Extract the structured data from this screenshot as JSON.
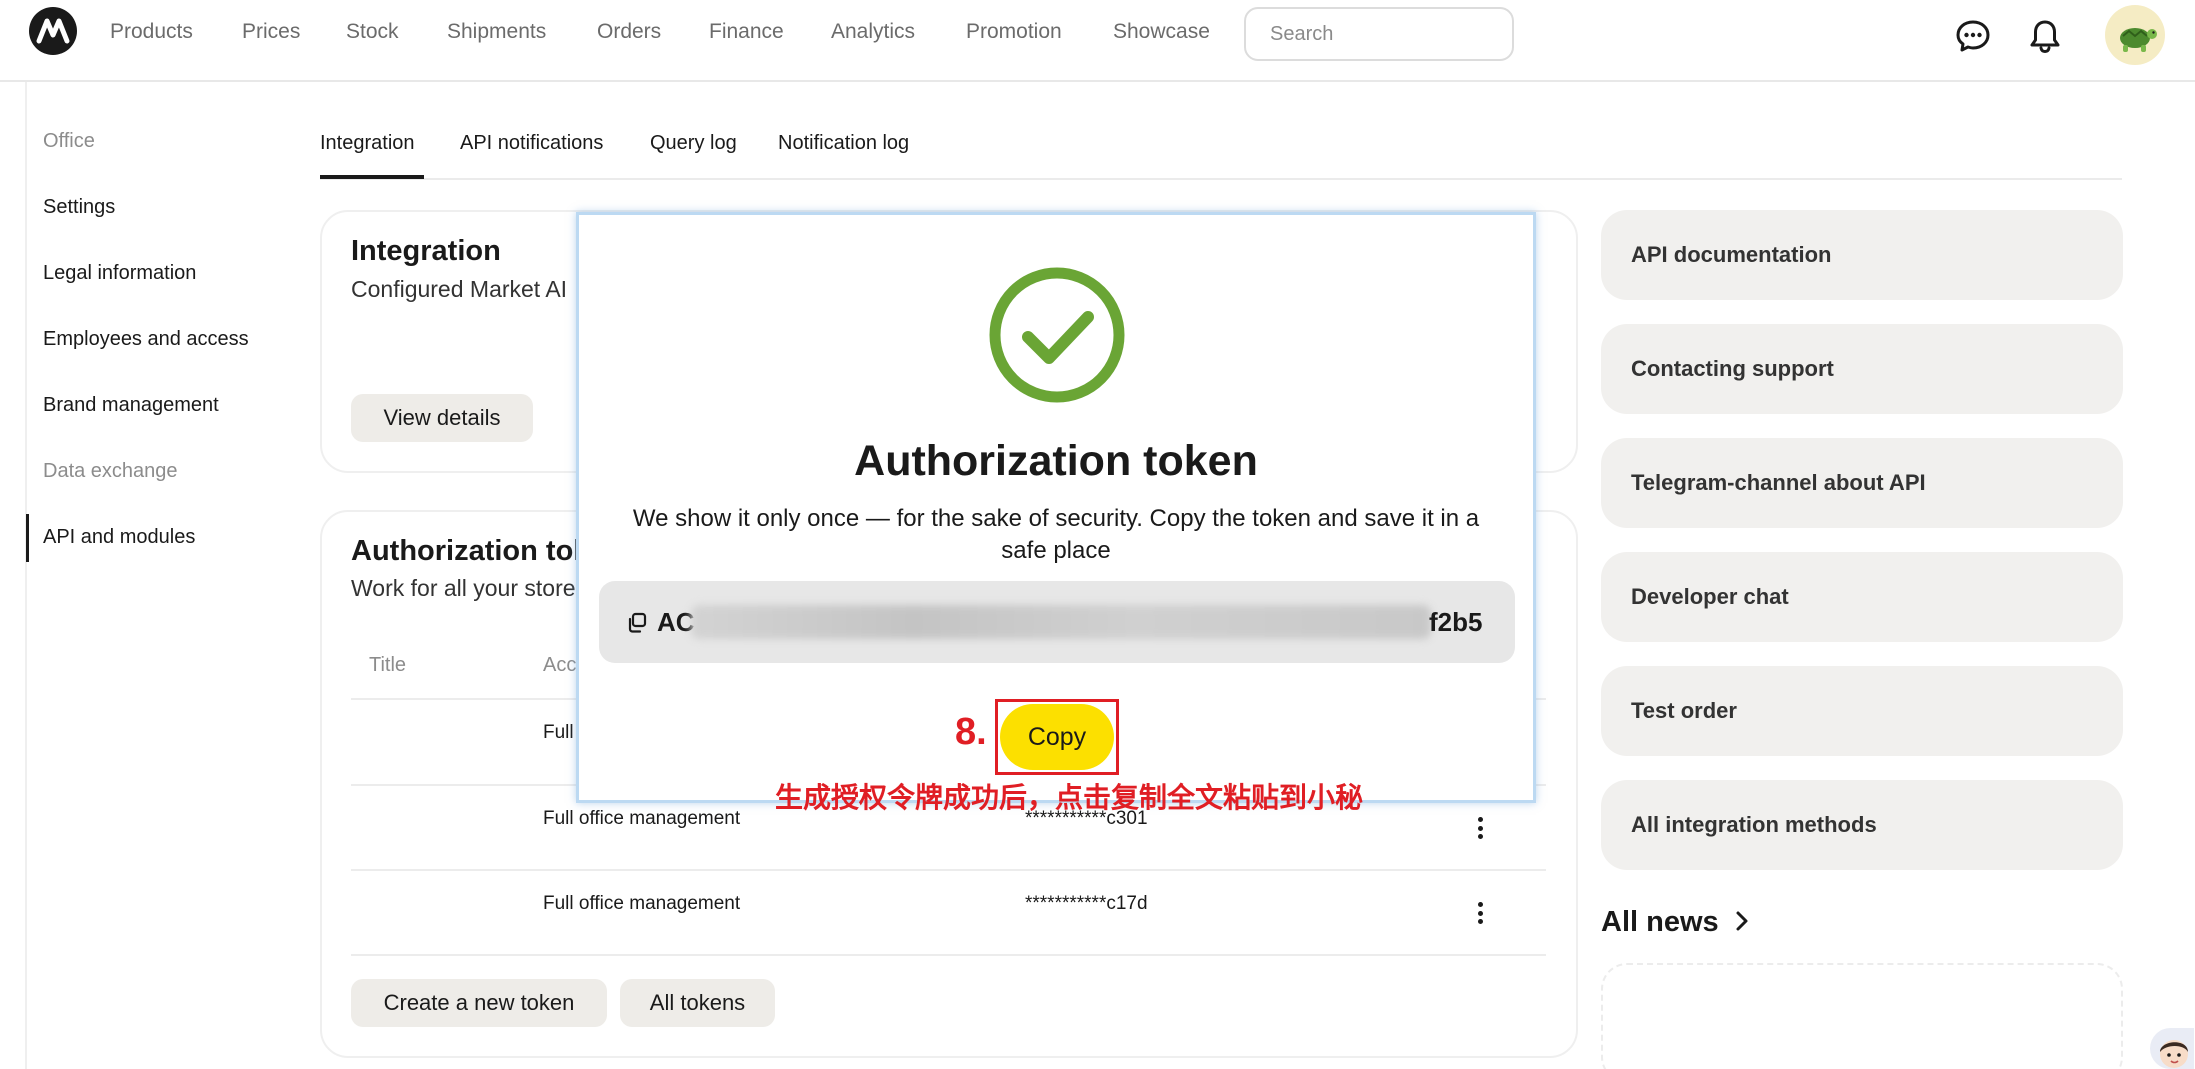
{
  "nav": {
    "items": [
      "Products",
      "Prices",
      "Stock",
      "Shipments",
      "Orders",
      "Finance",
      "Analytics",
      "Promotion",
      "Showcase"
    ],
    "search_placeholder": "Search"
  },
  "sidebar": {
    "items": [
      {
        "label": "Office",
        "muted": true
      },
      {
        "label": "Settings",
        "muted": false
      },
      {
        "label": "Legal information",
        "muted": false
      },
      {
        "label": "Employees and access",
        "muted": false
      },
      {
        "label": "Brand management",
        "muted": false
      },
      {
        "label": "Data exchange",
        "muted": true
      },
      {
        "label": "API and modules",
        "muted": false,
        "active": true
      }
    ]
  },
  "tabs": [
    "Integration",
    "API notifications",
    "Query log",
    "Notification log"
  ],
  "integration_card": {
    "title": "Integration",
    "subtitle": "Configured Market AI",
    "button": "View details"
  },
  "tokens_card": {
    "title": "Authorization tok",
    "subtitle": "Work for all your store",
    "columns": [
      "Title",
      "Acc"
    ],
    "rows": [
      {
        "access": "Full",
        "token": ""
      },
      {
        "access": "Full office management",
        "token": "***********c301"
      },
      {
        "access": "Full office management",
        "token": "***********c17d"
      }
    ],
    "create_button": "Create a new token",
    "all_tokens_button": "All tokens"
  },
  "right_panel": {
    "links": [
      "API documentation",
      "Contacting support",
      "Telegram-channel about API",
      "Developer chat",
      "Test order",
      "All integration methods"
    ],
    "all_news": "All news"
  },
  "modal": {
    "title": "Authorization token",
    "text": "We show it only once — for the sake of security. Copy the token and save it in a safe place",
    "token_start": "AC",
    "token_end": "f2b5",
    "copy_button": "Copy"
  },
  "annotation": {
    "step": "8.",
    "text": "生成授权令牌成功后，点击复制全文粘贴到小秘",
    "color": "#e01e24"
  },
  "colors": {
    "accent_yellow": "#fce000",
    "success_green": "#6aa535",
    "annotation_red": "#e01e24"
  }
}
